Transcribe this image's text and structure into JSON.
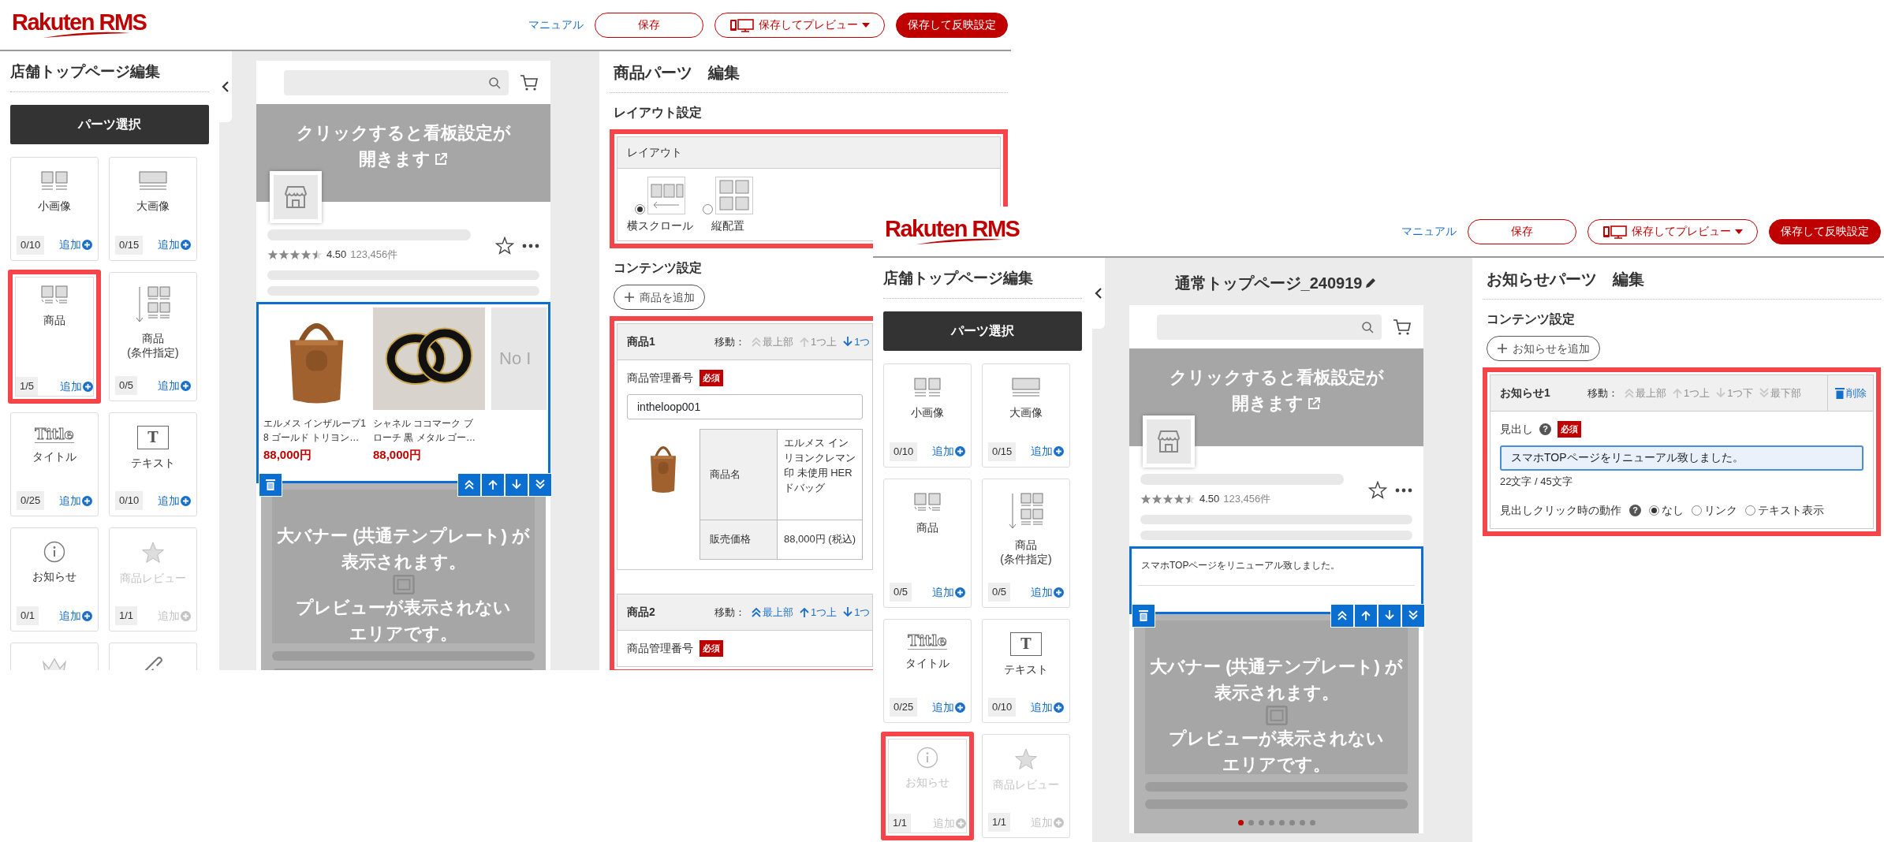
{
  "screens": [
    {
      "header": {
        "logo": "Rakuten RMS",
        "manual_link": "マニュアル",
        "buttons": [
          {
            "label": "保存",
            "kind": "save"
          },
          {
            "label": "保存してプレビュー",
            "kind": "preview"
          },
          {
            "label": "保存して反映設定",
            "kind": "publish"
          }
        ]
      },
      "sidebar": {
        "title": "店舗トップページ編集",
        "parts_button": "パーツ選択",
        "tiles": [
          {
            "kind": "small-image",
            "label": "小画像",
            "count": "0/10",
            "add": "追加",
            "disabled": false,
            "highlighted": false
          },
          {
            "kind": "large-image",
            "label": "大画像",
            "count": "0/15",
            "add": "追加",
            "disabled": false,
            "highlighted": false
          },
          {
            "kind": "item",
            "label": "商品",
            "count": "1/5",
            "add": "追加",
            "disabled": false,
            "highlighted": true
          },
          {
            "kind": "item-filter",
            "label": "商品",
            "sublabel": "(条件指定)",
            "count": "0/5",
            "add": "追加",
            "disabled": false,
            "highlighted": false
          },
          {
            "kind": "title",
            "icon_text": "Title",
            "label": "タイトル",
            "count": "0/25",
            "add": "追加",
            "disabled": false,
            "highlighted": false
          },
          {
            "kind": "text",
            "icon_text": "T",
            "label": "テキスト",
            "count": "0/10",
            "add": "追加",
            "disabled": false,
            "highlighted": false
          },
          {
            "kind": "notice",
            "label": "お知らせ",
            "count": "0/1",
            "add": "追加",
            "disabled": false,
            "highlighted": false
          },
          {
            "kind": "review",
            "label": "商品レビュー",
            "count": "1/1",
            "add": "追加",
            "disabled": true,
            "highlighted": false
          },
          {
            "kind": "ranking",
            "disabled": true,
            "highlighted": false
          },
          {
            "kind": "link",
            "disabled": false,
            "highlighted": false
          }
        ]
      },
      "preview": {
        "banner_lines": [
          "クリックすると看板設定が",
          "開きます"
        ],
        "stars": 4.5,
        "rating": "4.50",
        "review_count": "123,456件",
        "module": {
          "kind": "products",
          "products": [
            {
              "name_lines": [
                "エルメス インザループ1",
                "8 ゴールド トリヨン…"
              ],
              "price": "88,000円"
            },
            {
              "name_lines": [
                "シャネル ココマーク ブ",
                "ローチ 黒 メタル ゴー…"
              ],
              "price": "88,000円"
            }
          ],
          "placeholder": "No I"
        },
        "big_banner_lines": [
          "大バナー (共通テンプレート) が",
          "表示されます。",
          "プレビューが表示されない",
          "エリアです。"
        ]
      },
      "editor": {
        "title": "商品パーツ　編集",
        "sections": [
          {
            "kind": "layout",
            "heading": "レイアウト設定",
            "highlighted": true,
            "panel_title": "レイアウト",
            "options": [
              {
                "kind": "scroll",
                "label": "横スクロール",
                "selected": true
              },
              {
                "kind": "grid",
                "label": "縦配置",
                "selected": false
              }
            ]
          },
          {
            "kind": "contents",
            "heading": "コンテンツ設定",
            "add_button": "商品を追加",
            "highlighted": true,
            "items": [
              {
                "title": "商品1",
                "move_label": "移動：",
                "moves": [
                  {
                    "kind": "top",
                    "label": "最上部",
                    "disabled": true
                  },
                  {
                    "kind": "up",
                    "label": "1つ上",
                    "disabled": true
                  },
                  {
                    "kind": "down",
                    "label": "1つ",
                    "disabled": false
                  }
                ],
                "fields": [
                  {
                    "kind": "text-input",
                    "label": "商品管理番号",
                    "required": "必須",
                    "value": "intheloop001",
                    "focused": false
                  },
                  {
                    "kind": "product-info",
                    "rows": [
                      {
                        "label": "商品名",
                        "lines": [
                          "エルメス イン",
                          "リヨンクレマン",
                          "印 未使用 HER",
                          "ドバッグ"
                        ]
                      },
                      {
                        "label": "販売価格",
                        "lines": [
                          "88,000円 (税込)"
                        ]
                      }
                    ]
                  }
                ]
              },
              {
                "title": "商品2",
                "move_label": "移動：",
                "moves": [
                  {
                    "kind": "top",
                    "label": "最上部",
                    "disabled": false
                  },
                  {
                    "kind": "up",
                    "label": "1つ上",
                    "disabled": false
                  },
                  {
                    "kind": "down",
                    "label": "1つ",
                    "disabled": false
                  }
                ],
                "fields": [
                  {
                    "kind": "text-input",
                    "label": "商品管理番号",
                    "required": "必須"
                  }
                ]
              }
            ]
          }
        ]
      }
    },
    {
      "header": {
        "logo": "Rakuten RMS",
        "manual_link": "マニュアル",
        "buttons": [
          {
            "label": "保存",
            "kind": "save"
          },
          {
            "label": "保存してプレビュー",
            "kind": "preview"
          },
          {
            "label": "保存して反映設定",
            "kind": "publish"
          }
        ]
      },
      "sidebar": {
        "title": "店舗トップページ編集",
        "parts_button": "パーツ選択",
        "tiles": [
          {
            "kind": "small-image",
            "label": "小画像",
            "count": "0/10",
            "add": "追加",
            "disabled": false,
            "highlighted": false
          },
          {
            "kind": "large-image",
            "label": "大画像",
            "count": "0/15",
            "add": "追加",
            "disabled": false,
            "highlighted": false
          },
          {
            "kind": "item",
            "label": "商品",
            "count": "0/5",
            "add": "追加",
            "disabled": false,
            "highlighted": false
          },
          {
            "kind": "item-filter",
            "label": "商品",
            "sublabel": "(条件指定)",
            "count": "0/5",
            "add": "追加",
            "disabled": false,
            "highlighted": false
          },
          {
            "kind": "title",
            "icon_text": "Title",
            "label": "タイトル",
            "count": "0/25",
            "add": "追加",
            "disabled": false,
            "highlighted": false
          },
          {
            "kind": "text",
            "icon_text": "T",
            "label": "テキスト",
            "count": "0/10",
            "add": "追加",
            "disabled": false,
            "highlighted": false
          },
          {
            "kind": "notice",
            "label": "お知らせ",
            "count": "1/1",
            "add": "追加",
            "disabled": true,
            "highlighted": true
          },
          {
            "kind": "review",
            "label": "商品レビュー",
            "count": "1/1",
            "add": "追加",
            "disabled": true,
            "highlighted": false
          }
        ]
      },
      "preview": {
        "page_title": "通常トップページ_240919",
        "banner_lines": [
          "クリックすると看板設定が",
          "開きます"
        ],
        "stars": 4.5,
        "rating": "4.50",
        "review_count": "123,456件",
        "module": {
          "kind": "notice",
          "text": "スマホTOPページをリニューアル致しました。"
        },
        "big_banner_lines": [
          "大バナー (共通テンプレート) が",
          "表示されます。",
          "プレビューが表示されない",
          "エリアです。"
        ],
        "dots": [
          {
            "selected": true
          },
          {
            "selected": false
          },
          {
            "selected": false
          },
          {
            "selected": false
          },
          {
            "selected": false
          },
          {
            "selected": false
          },
          {
            "selected": false
          },
          {
            "selected": false
          }
        ]
      },
      "editor": {
        "title": "お知らせパーツ　編集",
        "sections": [
          {
            "kind": "contents",
            "heading": "コンテンツ設定",
            "add_button": "お知らせを追加",
            "highlighted": true,
            "items": [
              {
                "title": "お知らせ1",
                "move_label": "移動：",
                "moves": [
                  {
                    "kind": "top",
                    "label": "最上部",
                    "disabled": true
                  },
                  {
                    "kind": "up",
                    "label": "1つ上",
                    "disabled": true
                  },
                  {
                    "kind": "down",
                    "label": "1つ下",
                    "disabled": true
                  },
                  {
                    "kind": "bottom",
                    "label": "最下部",
                    "disabled": true
                  }
                ],
                "delete": "削除",
                "fields": [
                  {
                    "kind": "text-input",
                    "label": "見出し",
                    "help": "?",
                    "required": "必須",
                    "value": "スマホTOPページをリニューアル致しました。",
                    "focused": true,
                    "counter": "22文字 / 45文字"
                  },
                  {
                    "kind": "radio-group",
                    "label": "見出しクリック時の動作",
                    "help": "?",
                    "options": [
                      {
                        "label": "なし",
                        "selected": true
                      },
                      {
                        "label": "リンク",
                        "selected": false
                      },
                      {
                        "label": "テキスト表示",
                        "selected": false
                      }
                    ]
                  }
                ]
              }
            ]
          }
        ]
      }
    }
  ]
}
